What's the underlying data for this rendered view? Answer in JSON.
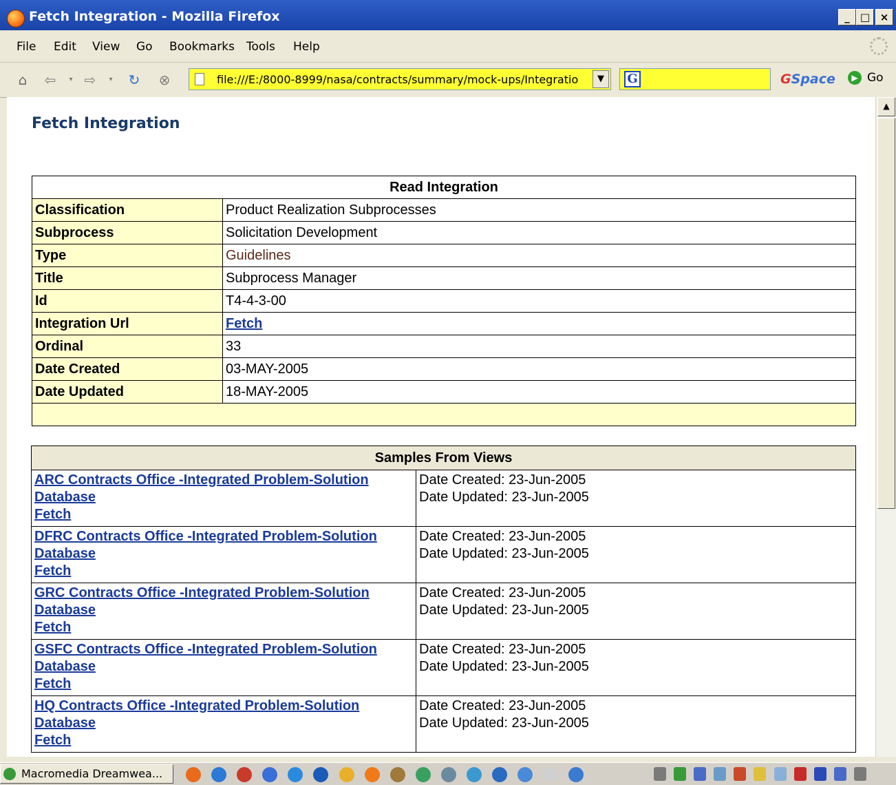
{
  "window": {
    "title": "Fetch Integration - Mozilla Firefox",
    "controls": [
      "_",
      "□",
      "×"
    ]
  },
  "menu": {
    "items": [
      "File",
      "Edit",
      "View",
      "Go",
      "Bookmarks",
      "Tools",
      "Help"
    ]
  },
  "toolbar": {
    "url": "file:///E:/8000-8999/nasa/contracts/summary/mock-ups/Integratio",
    "search_value": "",
    "gspace_g": "G",
    "gspace_rest": "Space",
    "go_label": "Go"
  },
  "page": {
    "heading": "Fetch Integration",
    "read_table": {
      "header": "Read Integration",
      "rows": [
        {
          "label": "Classification",
          "value": "Product Realization Subprocesses"
        },
        {
          "label": "Subprocess",
          "value": "Solicitation Development"
        },
        {
          "label": "Type",
          "value": "Guidelines"
        },
        {
          "label": "Title",
          "value": "Subprocess Manager"
        },
        {
          "label": "Id",
          "value": "T4-4-3-00"
        },
        {
          "label": "Integration Url",
          "value": "Fetch"
        },
        {
          "label": "Ordinal",
          "value": "33"
        },
        {
          "label": "Date Created",
          "value": "03-MAY-2005"
        },
        {
          "label": "Date Updated",
          "value": "18-MAY-2005"
        }
      ]
    },
    "samples_table": {
      "header": "Samples From Views",
      "rows": [
        {
          "line1": "ARC Contracts Office -Integrated Problem-Solution",
          "line2": "Database",
          "line3": "Fetch",
          "created": "Date Created: 23-Jun-2005",
          "updated": "Date Updated: 23-Jun-2005"
        },
        {
          "line1": "DFRC Contracts Office -Integrated Problem-Solution",
          "line2": "Database",
          "line3": "Fetch",
          "created": "Date Created: 23-Jun-2005",
          "updated": "Date Updated: 23-Jun-2005"
        },
        {
          "line1": "GRC Contracts Office -Integrated Problem-Solution",
          "line2": "Database",
          "line3": "Fetch",
          "created": "Date Created: 23-Jun-2005",
          "updated": "Date Updated: 23-Jun-2005"
        },
        {
          "line1": "GSFC Contracts Office -Integrated Problem-Solution",
          "line2": "Database",
          "line3": "Fetch",
          "created": "Date Created: 23-Jun-2005",
          "updated": "Date Updated: 23-Jun-2005"
        },
        {
          "line1": "HQ Contracts Office -Integrated Problem-Solution",
          "line2": "Database",
          "line3": "Fetch",
          "created": "Date Created: 23-Jun-2005",
          "updated": "Date Updated: 23-Jun-2005"
        }
      ]
    }
  },
  "taskbar": {
    "active_task": "Macromedia Dreamwea..."
  },
  "colors": {
    "titlebar": "#1a44a8",
    "chrome": "#ece9d8",
    "label_bg": "#ffffcc",
    "url_bg": "#ffff33",
    "link": "#1a3a9a",
    "heading": "#1a3a6a"
  }
}
